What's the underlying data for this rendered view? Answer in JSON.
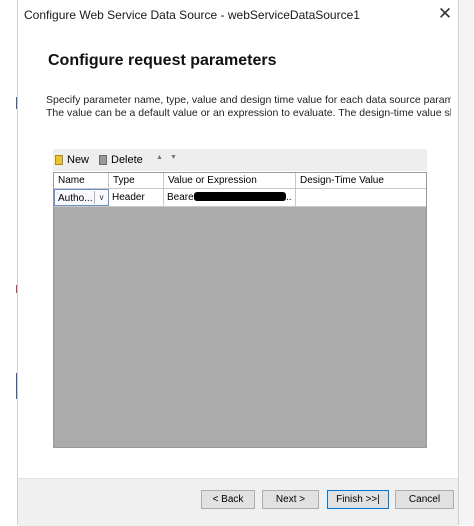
{
  "window": {
    "title": "Configure Web Service Data Source - webServiceDataSource1",
    "close_glyph": "✕"
  },
  "page": {
    "heading": "Configure request parameters",
    "description_line1": "Specify parameter name, type, value and design time value for each data source parameter.",
    "description_line2": "The value can be a default value or an expression to evaluate. The design-time value should"
  },
  "toolbar": {
    "new_label": "New",
    "delete_label": "Delete",
    "up_glyph": "▲",
    "down_glyph": "▼"
  },
  "grid": {
    "columns": [
      "Name",
      "Type",
      "Value or Expression",
      "Design-Time Value"
    ],
    "rows": [
      {
        "name": "Autho...",
        "type": "Header",
        "value": "Bearer",
        "value_suffix": "..",
        "design_time_value": ""
      }
    ]
  },
  "footer": {
    "back_label": "< Back",
    "next_label": "Next >",
    "finish_label": "Finish >>|",
    "cancel_label": "Cancel"
  },
  "colors": {
    "grid_background": "#ababab",
    "footer_background": "#f0f0f0",
    "default_button_border": "#0078d7"
  }
}
